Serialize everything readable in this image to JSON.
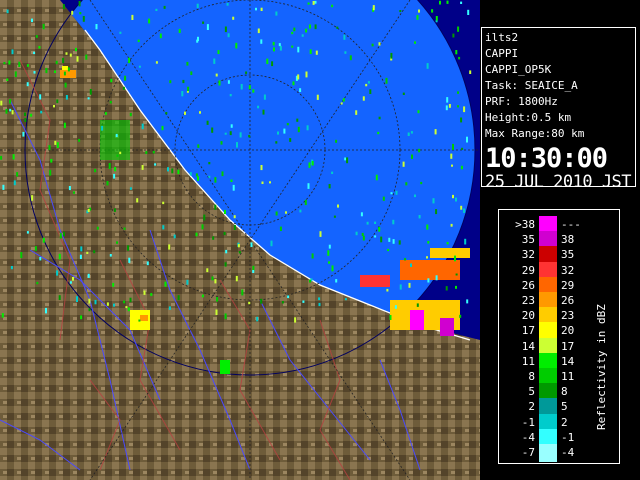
{
  "info": {
    "station": "ilts2",
    "product": "CAPPI",
    "product_id": "CAPPI_OP5K",
    "task": "Task: SEAICE_A",
    "prf": "PRF: 1800Hz",
    "height": "Height:0.5 km",
    "max_range": "Max Range:80 km",
    "time": "10:30:00",
    "date": "25 JUL 2010 JST"
  },
  "legend": {
    "unit_label": "Reflectivity in dBZ",
    "rows": [
      {
        "low": ">38",
        "high": "---",
        "color": "#ff00ff"
      },
      {
        "low": "35",
        "high": "38",
        "color": "#d000d0"
      },
      {
        "low": "32",
        "high": "35",
        "color": "#cc0000"
      },
      {
        "low": "29",
        "high": "32",
        "color": "#ff3333"
      },
      {
        "low": "26",
        "high": "29",
        "color": "#ff6600"
      },
      {
        "low": "23",
        "high": "26",
        "color": "#ff9900"
      },
      {
        "low": "20",
        "high": "23",
        "color": "#ffcc00"
      },
      {
        "low": "17",
        "high": "20",
        "color": "#ffff00"
      },
      {
        "low": "14",
        "high": "17",
        "color": "#ccff33"
      },
      {
        "low": "11",
        "high": "14",
        "color": "#00ee00"
      },
      {
        "low": "8",
        "high": "11",
        "color": "#00cc00"
      },
      {
        "low": "5",
        "high": "8",
        "color": "#009900"
      },
      {
        "low": "2",
        "high": "5",
        "color": "#009999"
      },
      {
        "low": "-1",
        "high": "2",
        "color": "#00cccc"
      },
      {
        "low": "-4",
        "high": "-1",
        "color": "#33ffff"
      },
      {
        "low": "-7",
        "high": "-4",
        "color": "#99ffff"
      }
    ]
  },
  "colors": {
    "sea": "#1464ff",
    "land": "#6b5a38",
    "outside": "#000088",
    "coastline": "#ffffff",
    "rivers": "#3a3aff",
    "contours": "#b03030"
  },
  "map": {
    "description_icon": "radar-map-icon"
  }
}
